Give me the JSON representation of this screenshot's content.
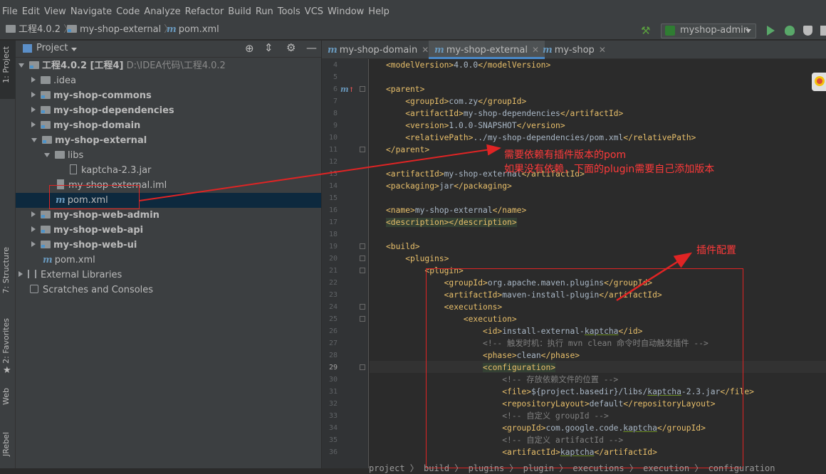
{
  "menu": [
    "File",
    "Edit",
    "View",
    "Navigate",
    "Code",
    "Analyze",
    "Refactor",
    "Build",
    "Run",
    "Tools",
    "VCS",
    "Window",
    "Help"
  ],
  "nav": {
    "project": "工程4.0.2",
    "module": "my-shop-external",
    "file": "pom.xml",
    "run_config": "myshop-admin"
  },
  "side_tabs": {
    "project": "1: Project",
    "structure": "7: Structure",
    "favorites": "2: Favorites",
    "web": "Web",
    "jrebel": "JRebel"
  },
  "project_panel": {
    "title": "Project",
    "root_name": "工程4.0.2 [工程4]",
    "root_path": "D:\\IDEA代码\\工程4.0.2",
    "items": [
      ".idea",
      "my-shop-commons",
      "my-shop-dependencies",
      "my-shop-domain",
      "my-shop-external",
      "libs",
      "kaptcha-2.3.jar",
      "my-shop-external.iml",
      "pom.xml",
      "my-shop-web-admin",
      "my-shop-web-api",
      "my-shop-web-ui",
      "pom.xml",
      "External Libraries",
      "Scratches and Consoles"
    ]
  },
  "editor_tabs": [
    "my-shop-domain",
    "my-shop-external",
    "my-shop"
  ],
  "line_numbers": [
    "4",
    "5",
    "6",
    "7",
    "8",
    "9",
    "10",
    "11",
    "12",
    "13",
    "14",
    "15",
    "16",
    "17",
    "18",
    "19",
    "20",
    "21",
    "22",
    "23",
    "24",
    "25",
    "26",
    "27",
    "28",
    "29",
    "30",
    "31",
    "32",
    "33",
    "34",
    "35",
    "36"
  ],
  "annotations": {
    "pom_note_1": "需要依赖有插件版本的pom",
    "pom_note_2": "如果没有依赖，下面的plugin需要自己添加版本",
    "plugin_note": "插件配置"
  },
  "breadcrumbs": "project  〉 build  〉 plugins  〉 plugin  〉 executions  〉 execution  〉 configuration",
  "colors": {
    "accent": "#4a88c7",
    "annotation": "#ff3a3a",
    "xml_tag": "#e8bf6a",
    "comment": "#808080"
  }
}
